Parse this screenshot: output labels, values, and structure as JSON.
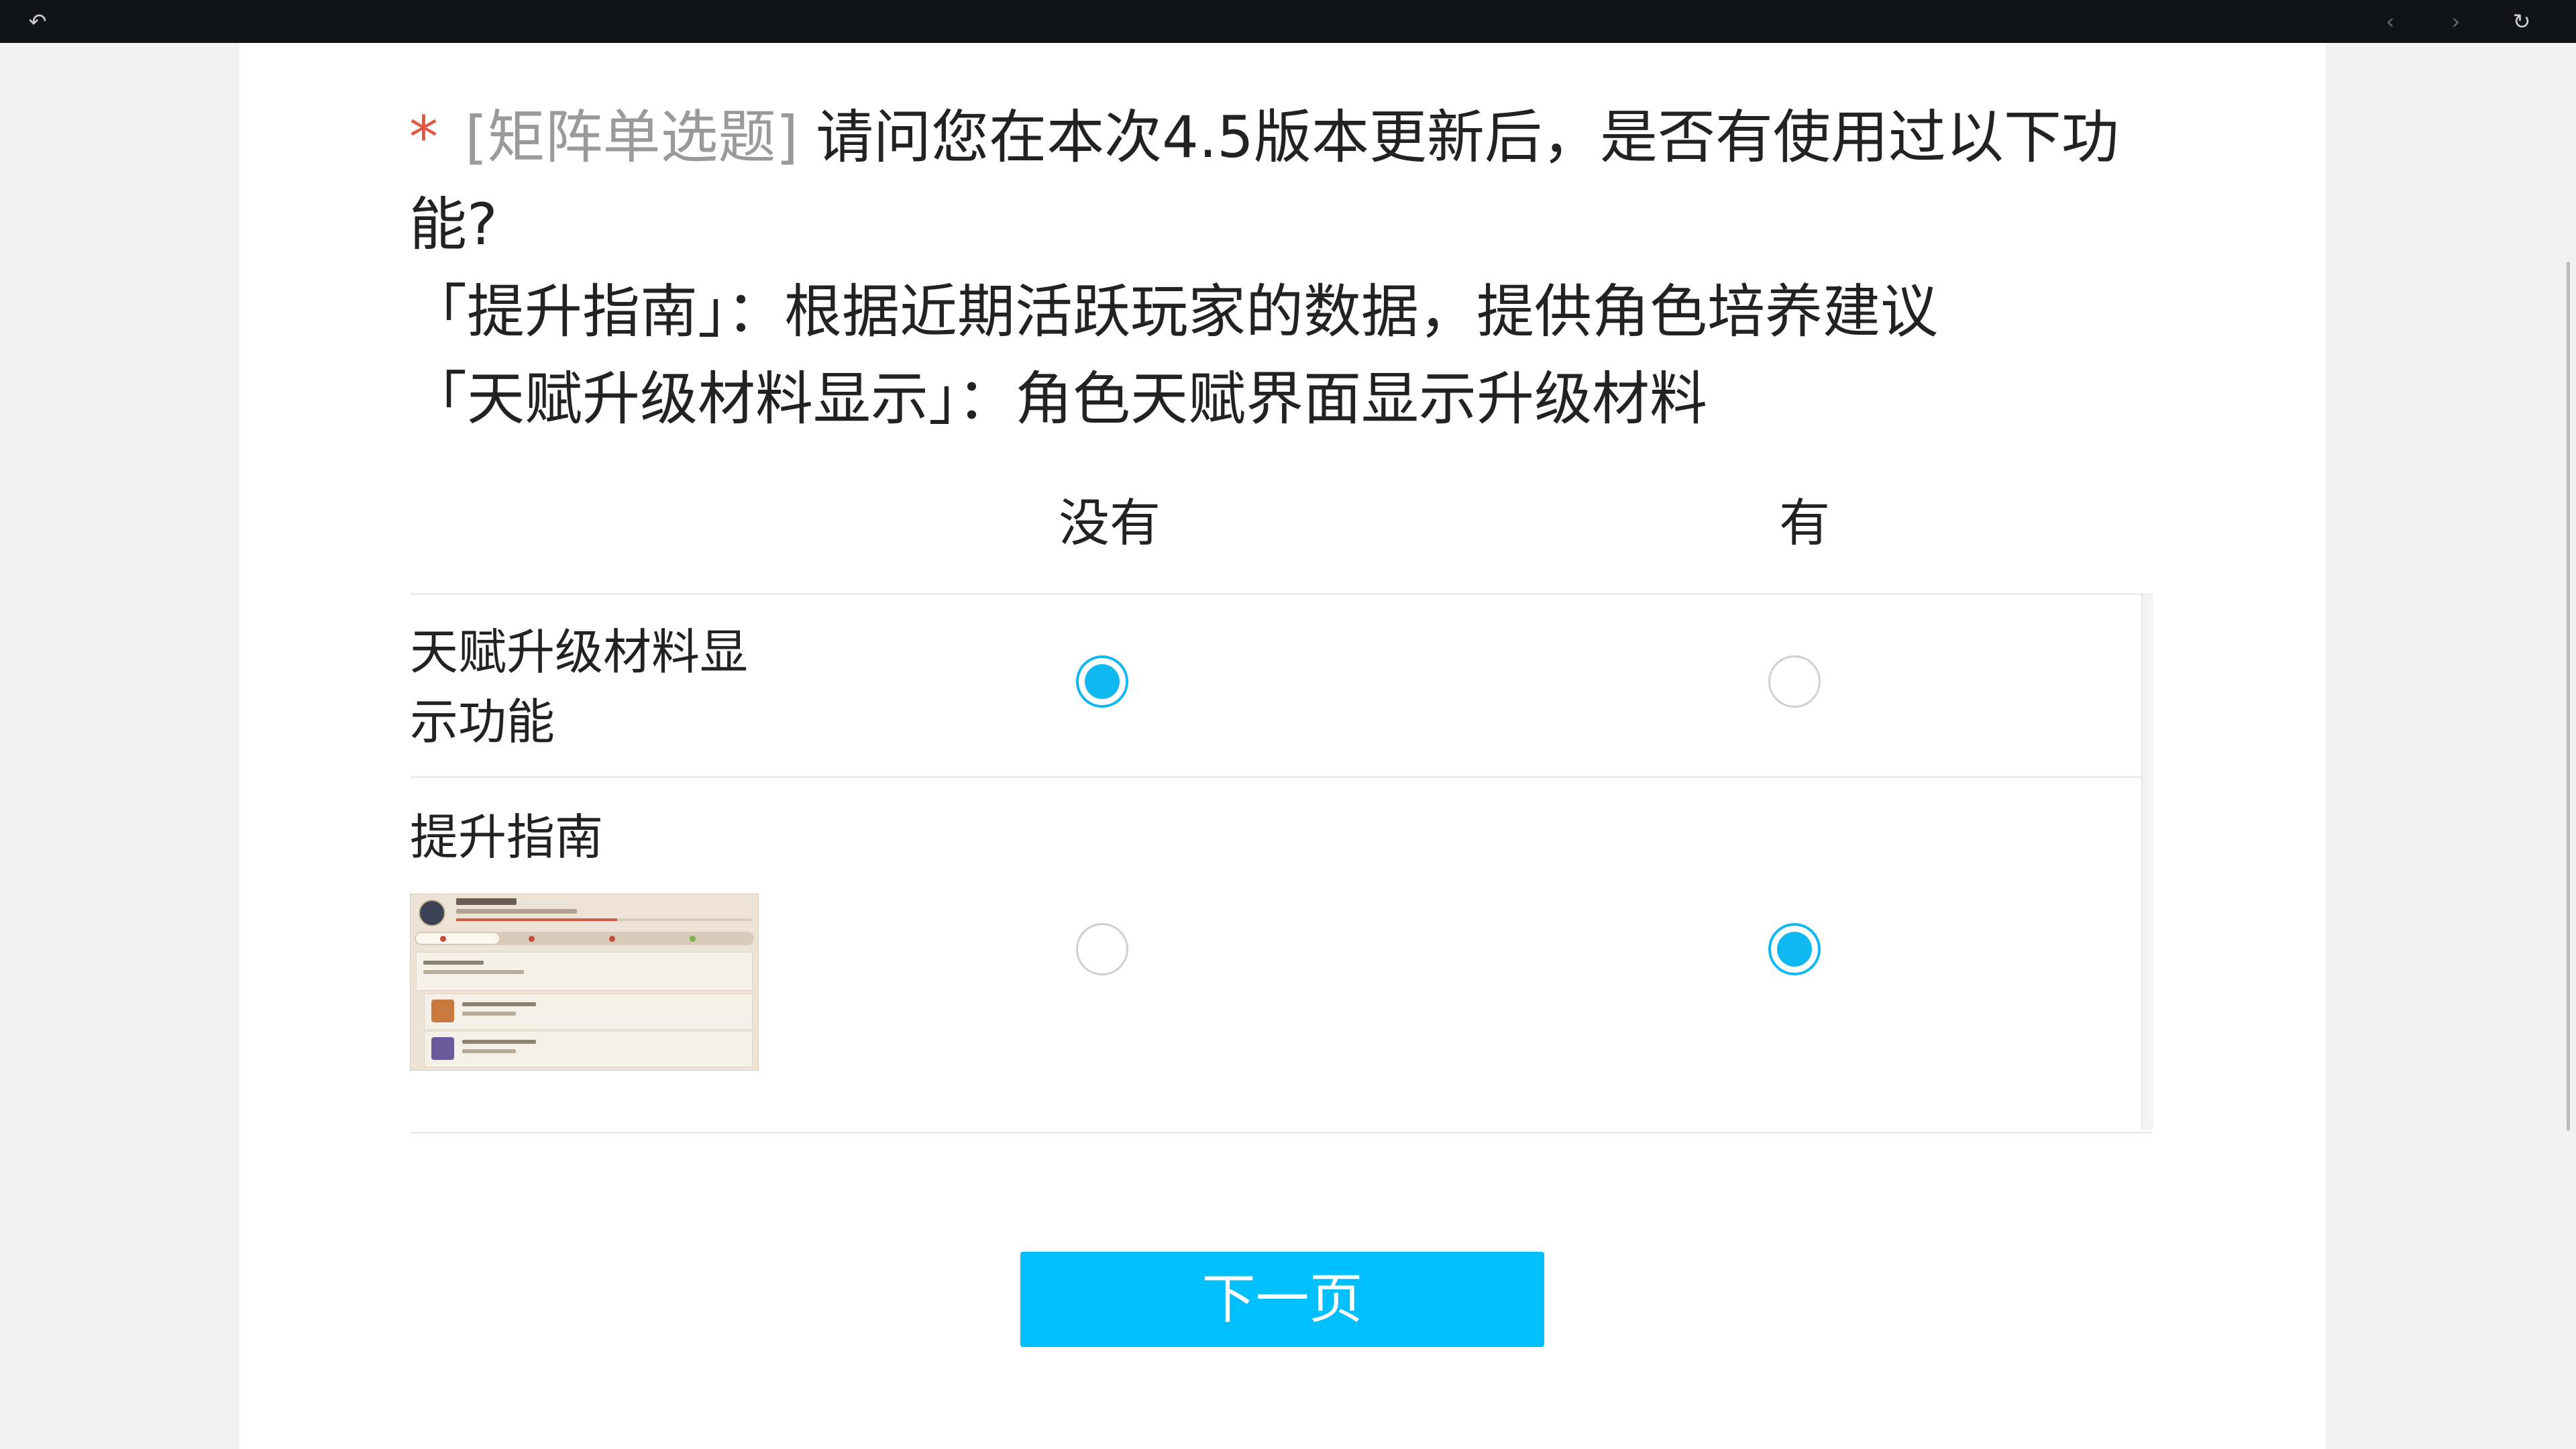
{
  "browser": {
    "back_icon": "back-arrow-icon",
    "prev_icon": "prev-arrow-icon",
    "next_icon": "next-arrow-icon",
    "reload_icon": "reload-icon"
  },
  "question": {
    "required_mark": "*",
    "type_label": "[矩阵单选题]",
    "title_line1": "请问您在本次4.5版本更新后，是否有使用过以下功",
    "title_line2": "能?",
    "desc_line1": "「提升指南」：根据近期活跃玩家的数据，提供角色培养建议",
    "desc_line2": "「天赋升级材料显示」：角色天赋界面显示升级材料"
  },
  "matrix": {
    "columns": [
      "没有",
      "有"
    ],
    "rows": [
      {
        "label": "天赋升级材料显示功能",
        "selected": "没有"
      },
      {
        "label": "提升指南",
        "selected": "有"
      }
    ]
  },
  "next_button": {
    "label": "下一页"
  },
  "colors": {
    "accent": "#00bfff",
    "radio_selected": "#10b8f2",
    "required": "#e4553d"
  }
}
